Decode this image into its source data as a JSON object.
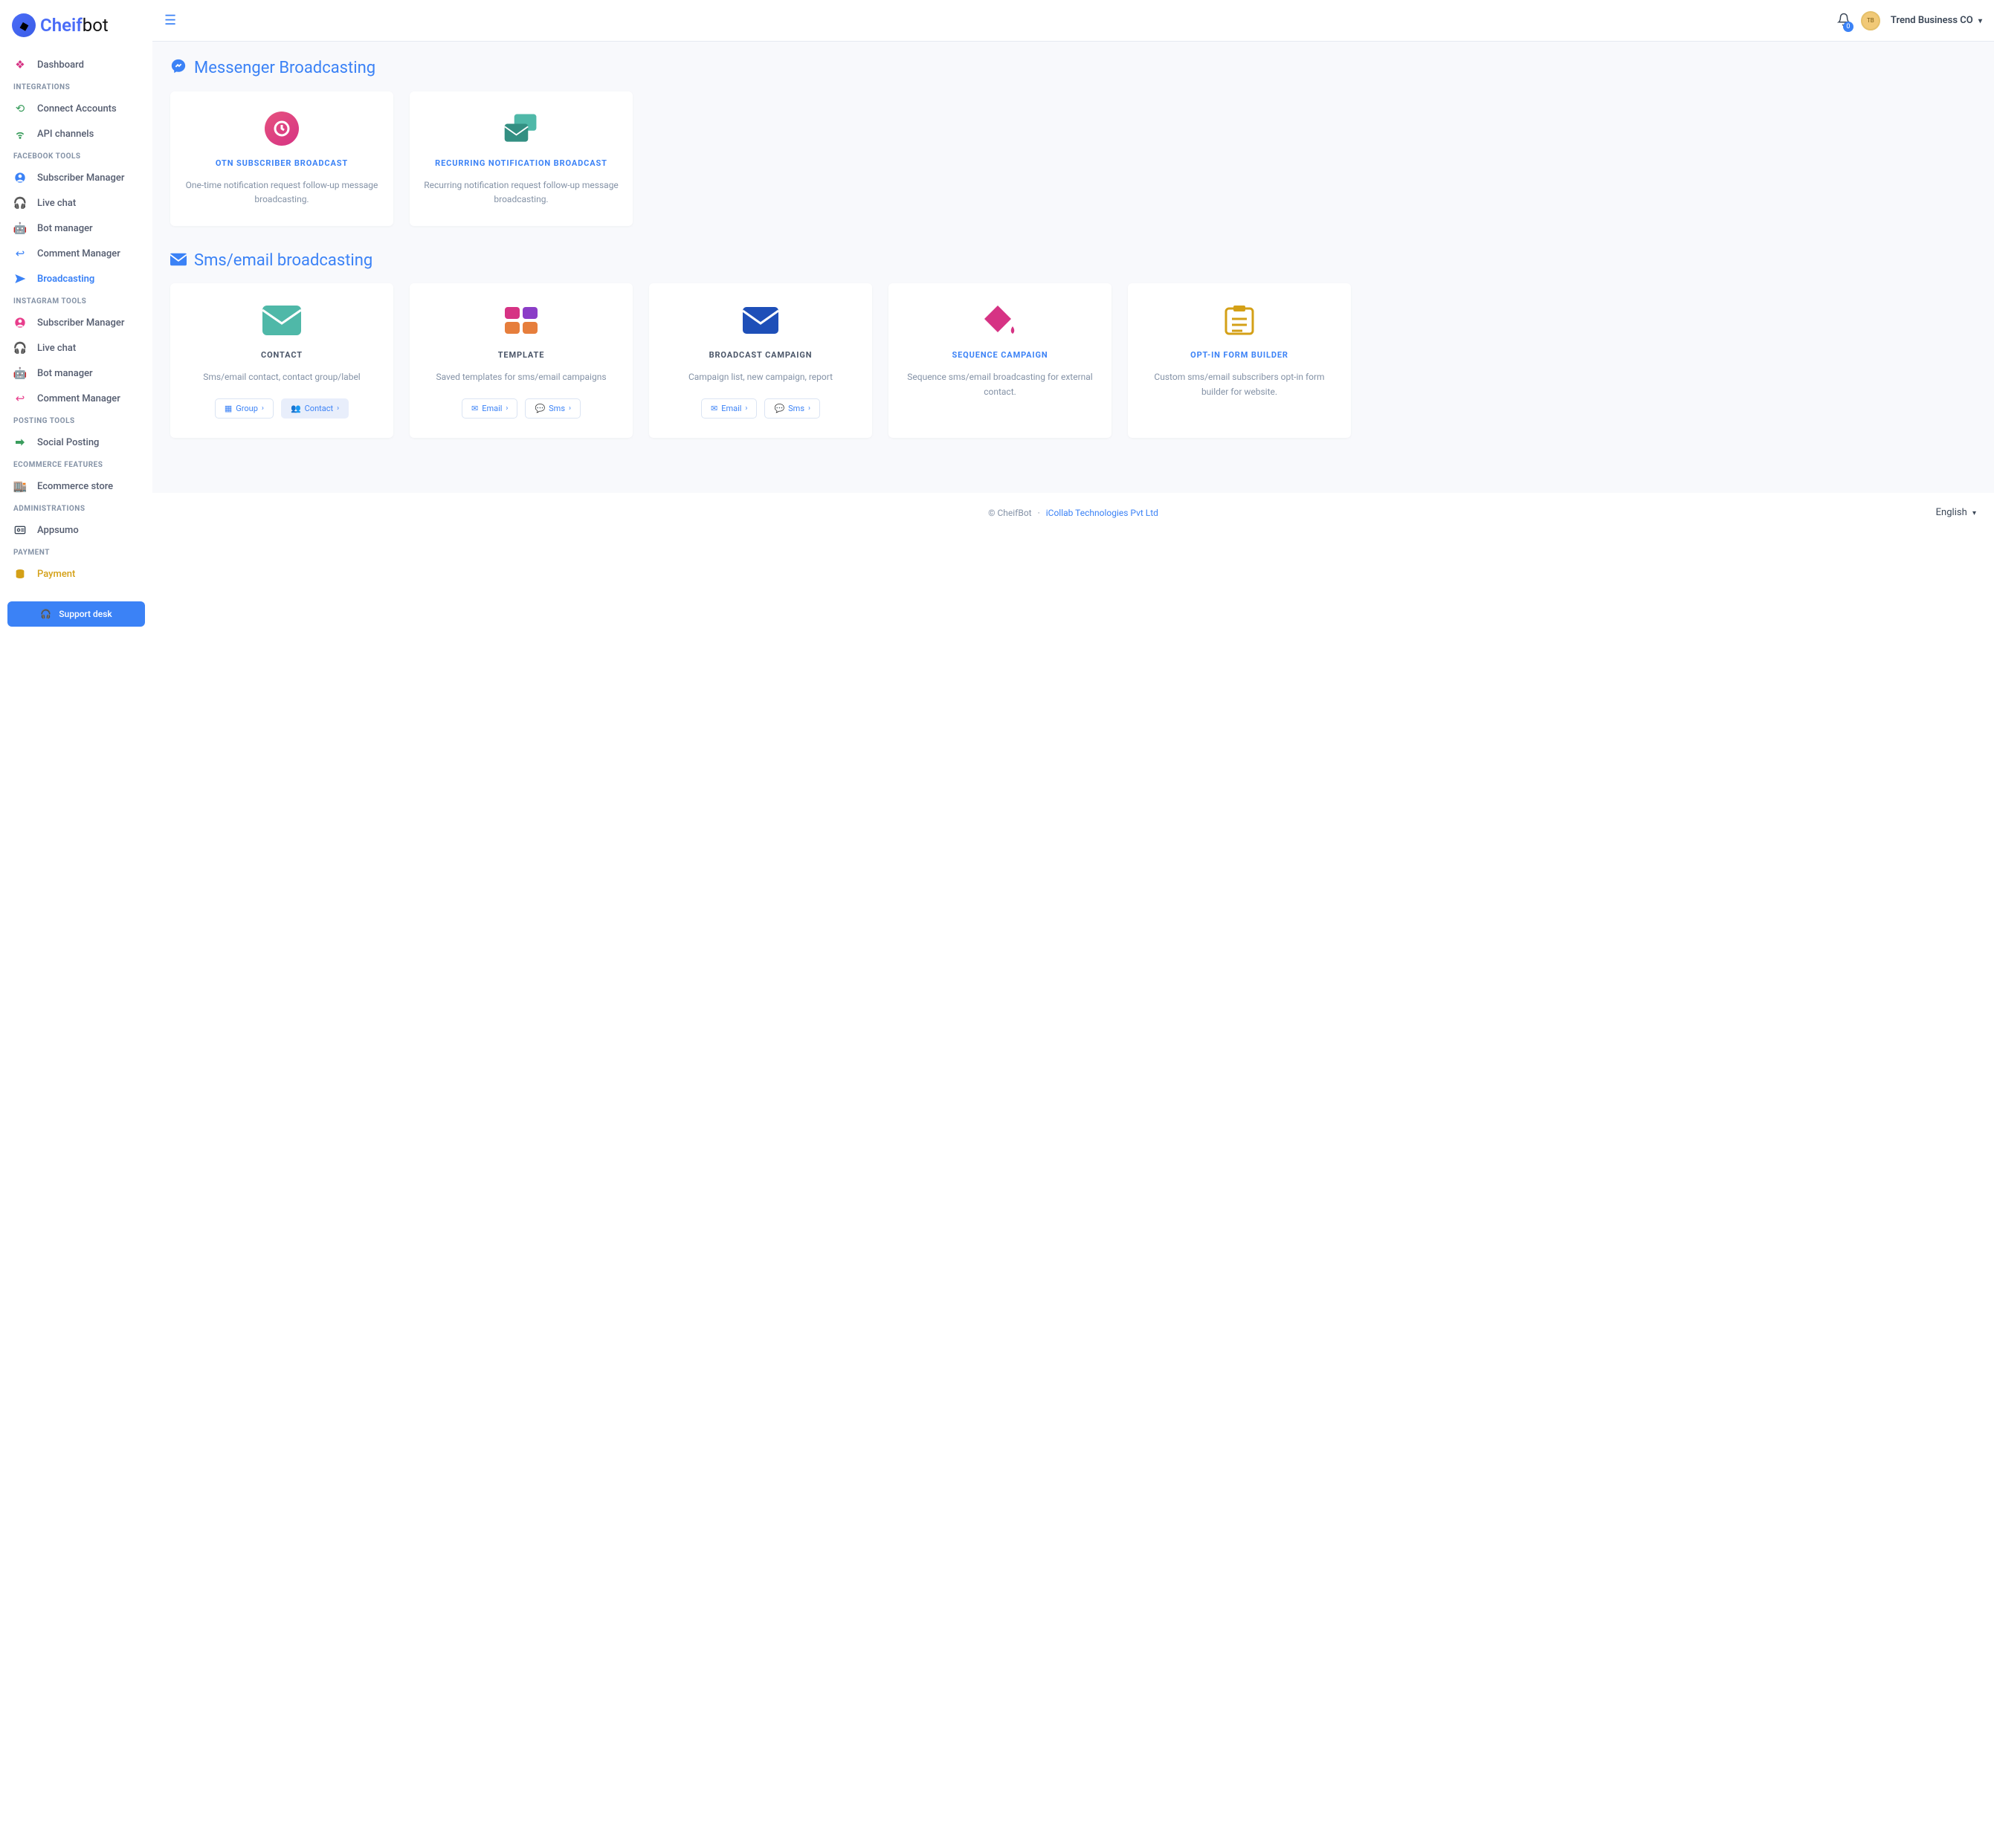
{
  "brand": {
    "name_a": "Cheif",
    "name_b": "bot"
  },
  "header": {
    "notif_count": "0",
    "user": "Trend Business CO"
  },
  "sidebar": {
    "dashboard": "Dashboard",
    "h_integrations": "INTEGRATIONS",
    "connect_accounts": "Connect Accounts",
    "api_channels": "API channels",
    "h_fbtools": "FACEBOOK TOOLS",
    "fb_subscriber_mgr": "Subscriber Manager",
    "fb_live_chat": "Live chat",
    "fb_bot_mgr": "Bot manager",
    "fb_comment_mgr": "Comment Manager",
    "fb_broadcasting": "Broadcasting",
    "h_igtools": "INSTAGRAM TOOLS",
    "ig_subscriber_mgr": "Subscriber Manager",
    "ig_live_chat": "Live chat",
    "ig_bot_mgr": "Bot manager",
    "ig_comment_mgr": "Comment Manager",
    "h_posting": "POSTING TOOLS",
    "social_posting": "Social Posting",
    "h_ecom": "ECOMMERCE FEATURES",
    "ecom_store": "Ecommerce store",
    "h_admin": "ADMINISTRATIONS",
    "appsumo": "Appsumo",
    "h_payment": "PAYMENT",
    "payment": "Payment",
    "support": "Support desk"
  },
  "sections": {
    "messenger_title": "Messenger Broadcasting",
    "sms_title": "Sms/email broadcasting"
  },
  "cards": {
    "otn": {
      "title": "OTN SUBSCRIBER BROADCAST",
      "desc": "One-time notification request follow-up message broadcasting."
    },
    "recurring": {
      "title": "RECURRING NOTIFICATION BROADCAST",
      "desc": "Recurring notification request follow-up message broadcasting."
    },
    "contact": {
      "title": "CONTACT",
      "desc": "Sms/email contact, contact group/label",
      "btn_group": "Group",
      "btn_contact": "Contact"
    },
    "template": {
      "title": "TEMPLATE",
      "desc": "Saved templates for sms/email campaigns",
      "btn_email": "Email",
      "btn_sms": "Sms"
    },
    "campaign": {
      "title": "BROADCAST CAMPAIGN",
      "desc": "Campaign list, new campaign, report",
      "btn_email": "Email",
      "btn_sms": "Sms"
    },
    "sequence": {
      "title": "SEQUENCE CAMPAIGN",
      "desc": "Sequence sms/email broadcasting for external contact."
    },
    "optin": {
      "title": "OPT-IN FORM BUILDER",
      "desc": "Custom sms/email subscribers opt-in form builder for website."
    }
  },
  "footer": {
    "copyright": "© CheifBot",
    "sep": "·",
    "link": "iCollab Technologies Pvt Ltd",
    "lang": "English"
  }
}
